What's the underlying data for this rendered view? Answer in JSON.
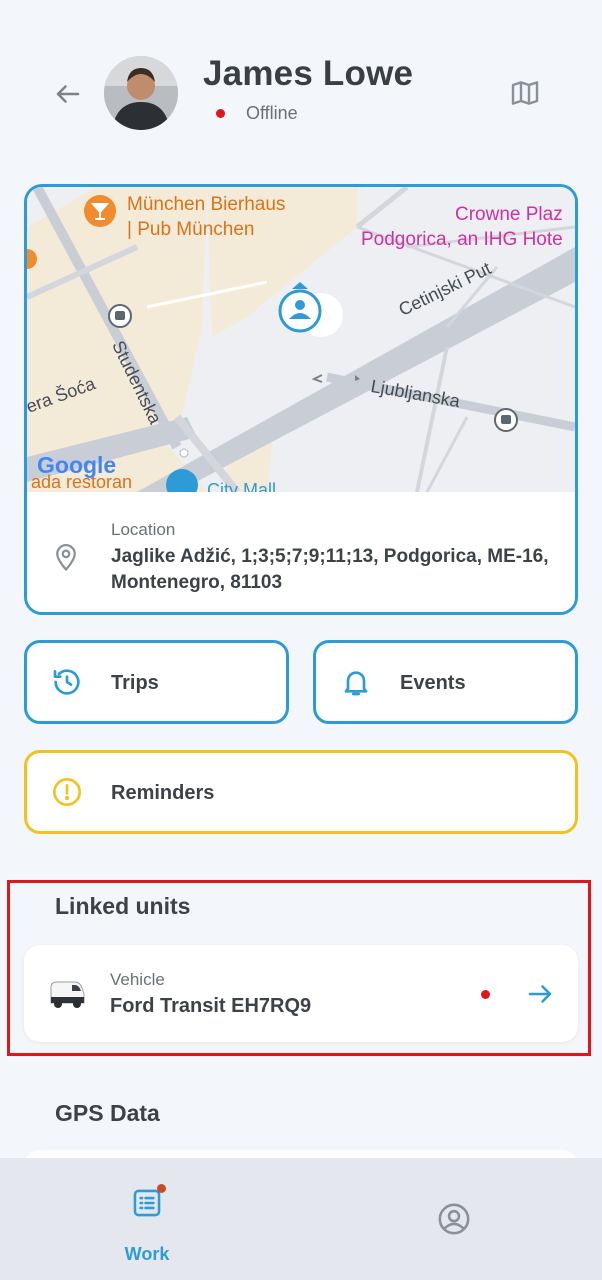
{
  "header": {
    "user_name": "James Lowe",
    "status": "Offline",
    "status_color": "#e0161a"
  },
  "map": {
    "labels": {
      "poi_pub": "München Bierhaus\n| Pub München",
      "poi_hotel": "Crowne Plaz\nPodgorica, an IHG Hote",
      "street_cetinjski": "Cetinjski Put",
      "street_studentska": "Studentska",
      "street_ljubljanska": "Ljubljanska",
      "street_soca": "era Šoća",
      "poi_restoran": "ada restoran",
      "poi_mall": "City Mall",
      "google_logo": "Google"
    }
  },
  "location": {
    "label": "Location",
    "address": "Jaglike Adžić, 1;3;5;7;9;11;13, Podgorica, ME-16, Montenegro, 81103"
  },
  "actions": {
    "trips": "Trips",
    "events": "Events",
    "reminders": "Reminders"
  },
  "linked_units": {
    "title": "Linked units",
    "unit": {
      "type": "Vehicle",
      "name": "Ford Transit EH7RQ9"
    }
  },
  "gps": {
    "title": "GPS Data"
  },
  "bottom_nav": {
    "work_label": "Work"
  },
  "colors": {
    "accent": "#2d9bd6",
    "warning": "#f2c31d",
    "highlight": "#e0161a"
  }
}
